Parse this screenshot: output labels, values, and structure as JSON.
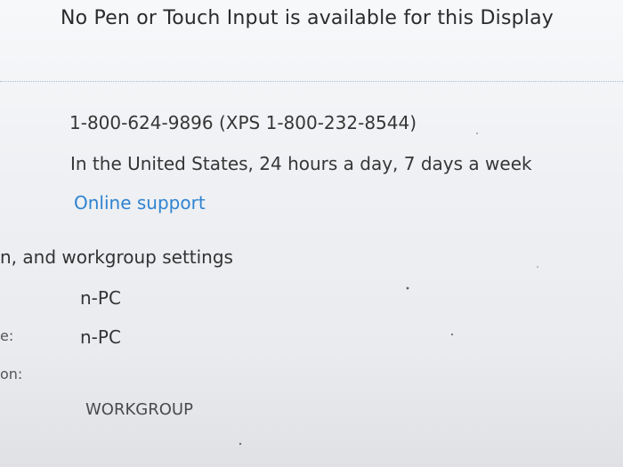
{
  "header": {
    "pen_touch_text": "No Pen or Touch Input is available for this Display"
  },
  "support": {
    "phone_text": "1-800-624-9896 (XPS 1-800-232-8544)",
    "hours_text": "In the United States, 24 hours a day, 7 days a week",
    "online_support_label": "Online support"
  },
  "network": {
    "section_title": "n, and workgroup settings",
    "rows": [
      {
        "label": "",
        "value": "n-PC"
      },
      {
        "label": "e:",
        "value": "n-PC"
      },
      {
        "label": "on:",
        "value": ""
      },
      {
        "label": "",
        "value": "WORKGROUP"
      }
    ]
  },
  "colors": {
    "link": "#2f83d0",
    "divider": "#9db8d7",
    "text": "#333333"
  }
}
